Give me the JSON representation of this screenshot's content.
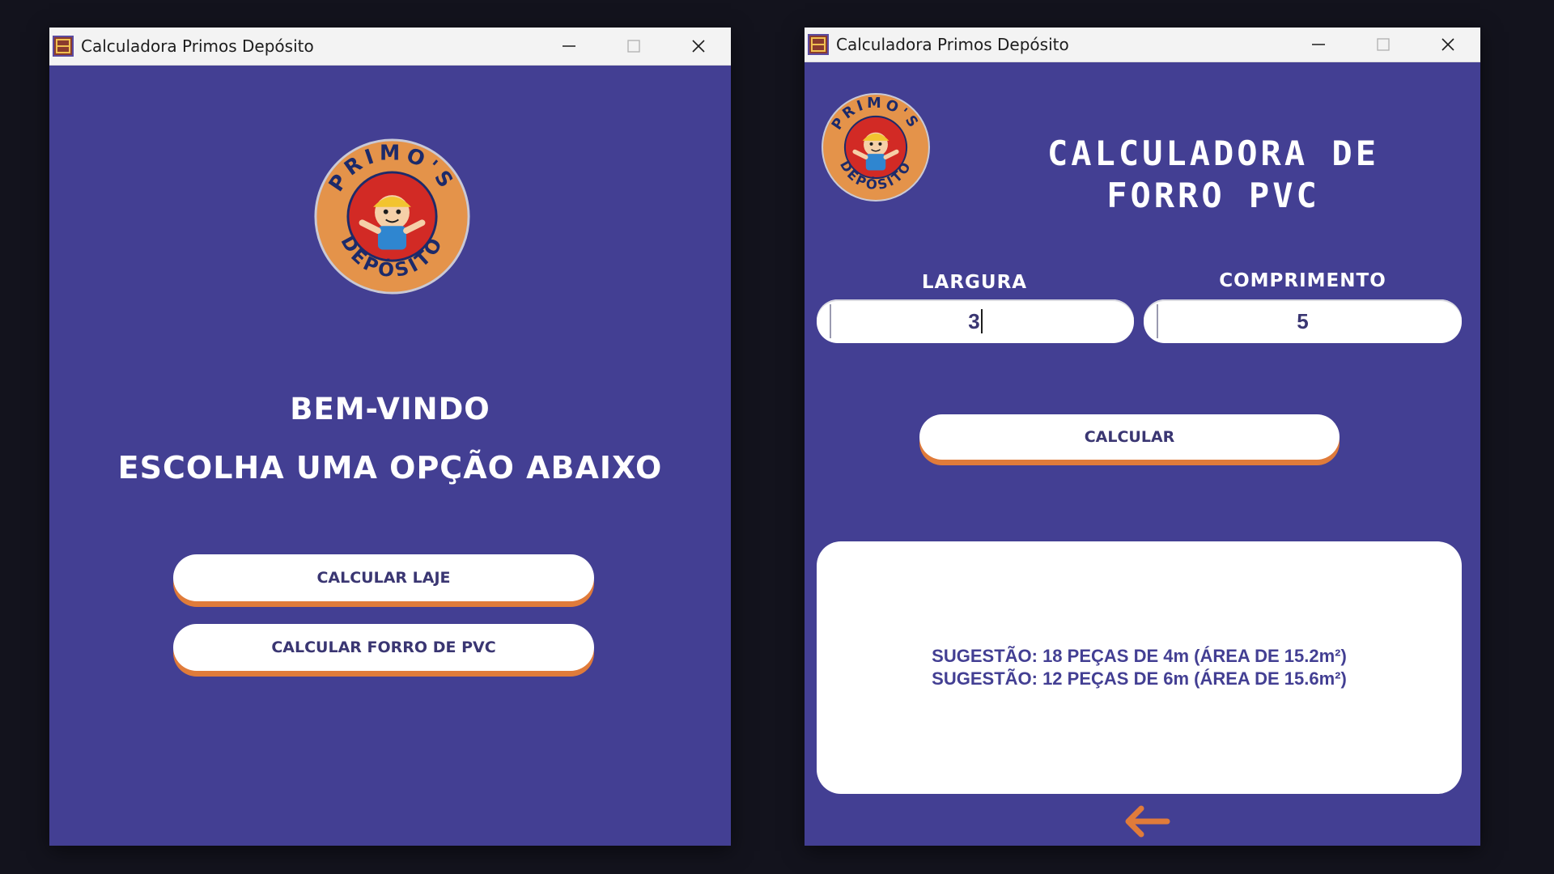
{
  "left_window": {
    "title": "Calculadora Primos Depósito",
    "welcome_line1": "BEM-VINDO",
    "welcome_line2": "ESCOLHA UMA OPÇÃO ABAIXO",
    "buttons": {
      "laje": "CALCULAR LAJE",
      "forro": "CALCULAR FORRO DE PVC"
    }
  },
  "right_window": {
    "title": "Calculadora Primos Depósito",
    "heading_line1": "CALCULADORA DE",
    "heading_line2": "FORRO PVC",
    "largura": {
      "label": "LARGURA",
      "value": "3"
    },
    "comprimento": {
      "label": "COMPRIMENTO",
      "value": "5"
    },
    "calcular_label": "CALCULAR",
    "results": [
      "SUGESTÃO: 18 PEÇAS DE 4m (ÁREA DE 15.2m²)",
      "SUGESTÃO: 12 PEÇAS DE 6m (ÁREA DE 15.6m²)"
    ]
  },
  "logo_text": "PRIMO'S DEPÓSITO",
  "colors": {
    "window_bg": "#433f93",
    "accent_orange": "#e07b3a",
    "logo_orange": "#e4934a",
    "logo_red": "#d22a25",
    "text_dark": "#3a3672"
  }
}
